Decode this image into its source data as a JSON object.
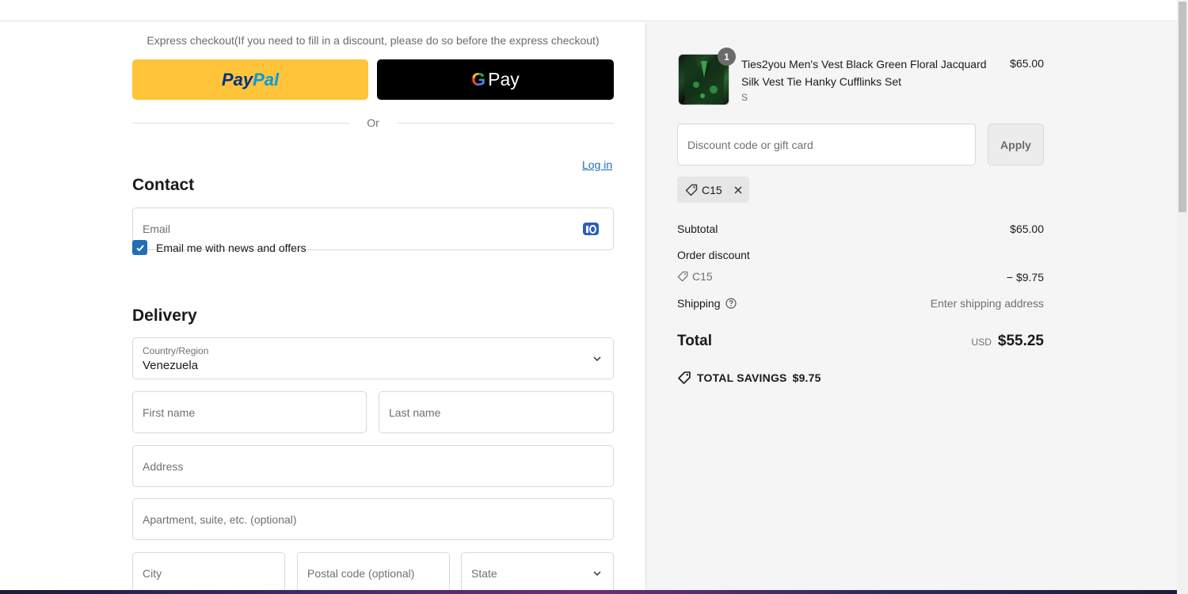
{
  "express": {
    "label": "Express checkout(If you need to fill in a discount, please do so before the express checkout)",
    "paypal_a": "Pay",
    "paypal_b": "Pal",
    "gpay_g": "G",
    "gpay_label": "Pay",
    "or_text": "Or"
  },
  "contact": {
    "title": "Contact",
    "login_label": "Log in",
    "email_placeholder": "Email",
    "newsletter_label": "Email me with news and offers",
    "newsletter_checked": true
  },
  "delivery": {
    "title": "Delivery",
    "country_label": "Country/Region",
    "country_value": "Venezuela",
    "first_name_placeholder": "First name",
    "last_name_placeholder": "Last name",
    "address_placeholder": "Address",
    "apartment_placeholder": "Apartment, suite, etc. (optional)",
    "city_placeholder": "City",
    "postal_placeholder": "Postal code (optional)",
    "state_placeholder": "State"
  },
  "cart": {
    "item": {
      "quantity": "1",
      "name": "Ties2you Men's Vest Black Green Floral Jacquard Silk Vest Tie Hanky Cufflinks Set",
      "variant": "S",
      "price": "$65.00"
    },
    "discount_placeholder": "Discount code or gift card",
    "apply_label": "Apply",
    "applied_code": "C15"
  },
  "summary": {
    "subtotal_label": "Subtotal",
    "subtotal_value": "$65.00",
    "order_discount_label": "Order discount",
    "discount_code": "C15",
    "discount_value": "− $9.75",
    "shipping_label": "Shipping",
    "shipping_value": "Enter shipping address",
    "total_label": "Total",
    "total_currency": "USD",
    "total_value": "$55.25",
    "savings_label": "TOTAL SAVINGS",
    "savings_value": "$9.75"
  },
  "colors": {
    "paypal_yellow": "#ffc439",
    "link_blue": "#1f6fb5",
    "panel_bg": "#f5f5f5"
  }
}
